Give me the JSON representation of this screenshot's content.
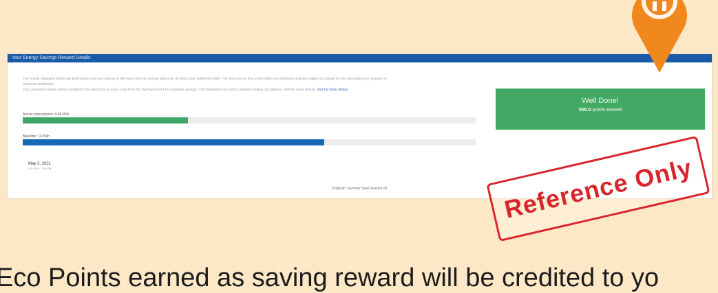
{
  "panel": {
    "header": "Your Energy Savings Reward Details",
    "disclaimer_lines": [
      "The results displayed below are preliminary and may change in the event that the savings amounts, at which your settlement date. The amounts on this confirmation are estimates and are subject to change for any discrepancy or dispute on",
      "accounts verification.",
      "Your calculated rebate will be credited to the electricity account used from this Savings Event for customer savings. Visit Submitted account to view the saving calculations. Visit for more details."
    ],
    "disclaimer_link": "Visit for more details",
    "bars": [
      {
        "label": "Actual consumption: 9.49 kWh",
        "fraction": 0.365,
        "color": "#3fa66a"
      },
      {
        "label": "Baseline: 14 kWh",
        "fraction": 0.665,
        "color": "#1569b4"
      }
    ],
    "date": "May 3, 2021",
    "time": "3:30 PM - 7:00 PM",
    "footer": "Program: Summer Save Session 03"
  },
  "well_done": {
    "title": "Well Done!",
    "points": "500.0",
    "points_label": "points earned"
  },
  "stamp": {
    "text": "Reference Only",
    "color": "#d8262e"
  },
  "caption": "Eco Points earned as saving reward will be credited to yo",
  "pin": {
    "icon": "map-pin-icon",
    "color": "#f0881e"
  }
}
